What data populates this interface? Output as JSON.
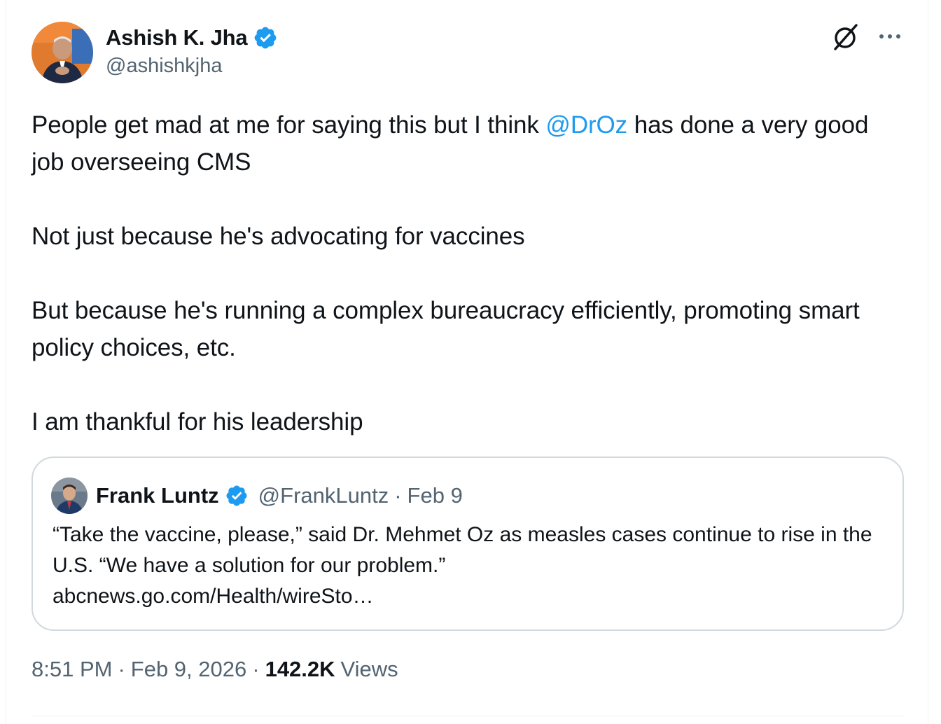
{
  "author": {
    "display_name": "Ashish K. Jha",
    "handle": "@ashishkjha",
    "verified": true,
    "avatar_icon": "person-photo-avatar"
  },
  "actions": {
    "grok_icon": "grok-icon",
    "more_icon": "more-horizontal-icon"
  },
  "tweet": {
    "line1_pre": "People get mad at me for saying this but I think ",
    "line1_mention": "@DrOz",
    "line1_post": " has done a very good job overseeing CMS",
    "para2": "Not just because he's advocating for vaccines",
    "para3": "But because he's running a complex bureaucracy efficiently, promoting smart policy choices, etc.",
    "para4": "I am thankful for his leadership"
  },
  "quote": {
    "display_name": "Frank Luntz",
    "handle": "@FrankLuntz",
    "date": "Feb 9",
    "dot": "·",
    "line1": "“Take the vaccine, please,” said Dr. Mehmet Oz as measles cases continue to rise in the U.S.  “We have a solution for our problem.”",
    "link": "abcnews.go.com/Health/wireSto…"
  },
  "meta": {
    "time": "8:51 PM",
    "date": "Feb 9, 2026",
    "dot": "·",
    "views_count": "142.2K",
    "views_label": "Views"
  },
  "colors": {
    "accent": "#1d9bf0",
    "text": "#0f1419",
    "secondary": "#536471",
    "border": "#cfd9de"
  }
}
